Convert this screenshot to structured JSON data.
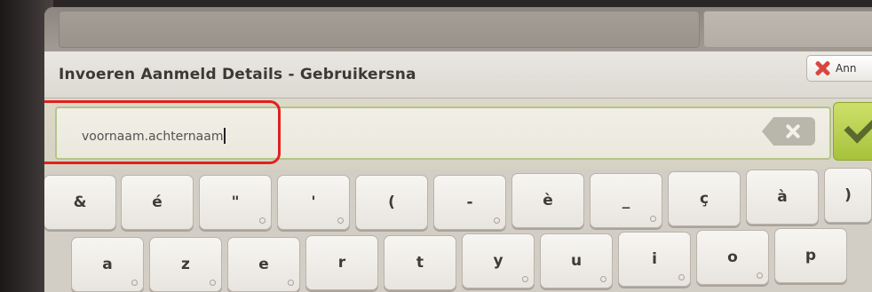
{
  "dialog": {
    "title": "Invoeren Aanmeld Details - Gebruikersna",
    "cancel_label": "Ann"
  },
  "input": {
    "value": "voornaam.achternaam"
  },
  "keyboard": {
    "row1": [
      "&",
      "é",
      "\"",
      "'",
      "(",
      "-",
      "è",
      "_",
      "ç",
      "à",
      ")"
    ],
    "row2": [
      "a",
      "z",
      "e",
      "r",
      "t",
      "y",
      "u",
      "i",
      "o",
      "p"
    ]
  }
}
